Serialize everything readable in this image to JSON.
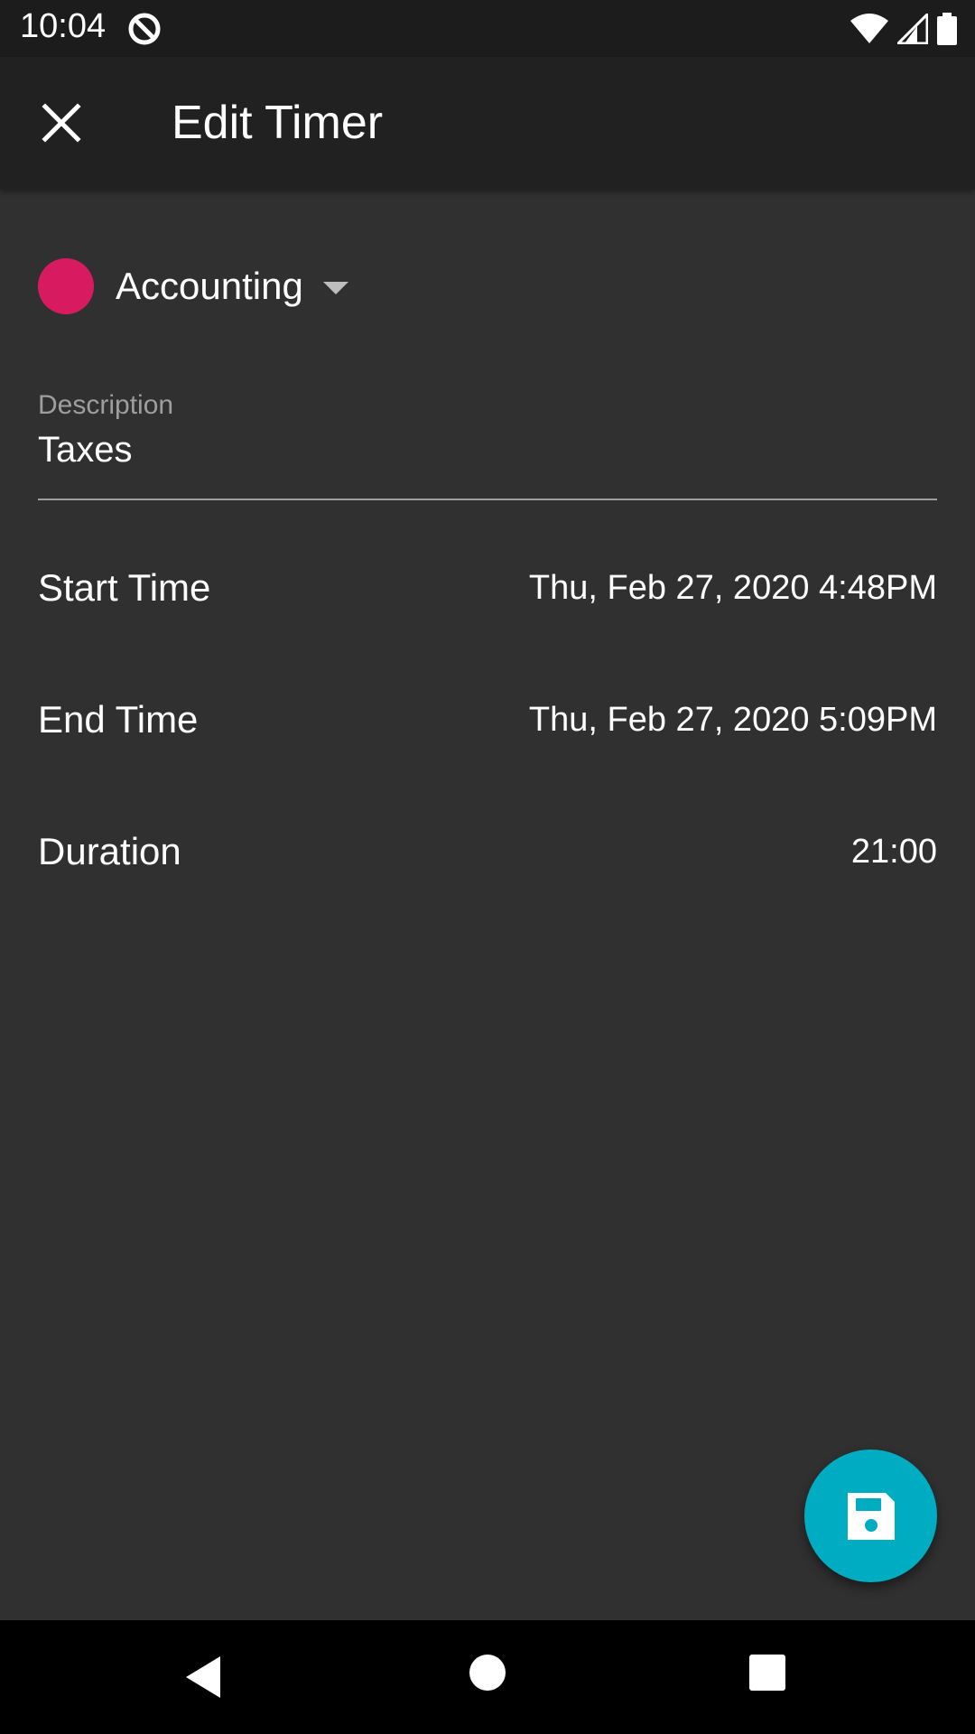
{
  "status_bar": {
    "time": "10:04",
    "icons": [
      "app-notification-icon",
      "wifi-icon",
      "cell-signal-icon",
      "battery-icon"
    ]
  },
  "app_bar": {
    "title": "Edit Timer",
    "close_icon": "close-icon"
  },
  "project": {
    "name": "Accounting",
    "color": "#d81b60",
    "dropdown_icon": "caret-down-icon"
  },
  "description": {
    "label": "Description",
    "value": "Taxes"
  },
  "rows": {
    "start": {
      "label": "Start Time",
      "value": "Thu, Feb 27, 2020 4:48PM"
    },
    "end": {
      "label": "End Time",
      "value": "Thu, Feb 27, 2020 5:09PM"
    },
    "duration": {
      "label": "Duration",
      "value": "21:00"
    }
  },
  "fab": {
    "icon": "save-icon",
    "color": "#00acc1"
  },
  "nav_bar": {
    "icons": [
      "back-icon",
      "home-icon",
      "recents-icon"
    ]
  },
  "theme": {
    "background": "#303030",
    "app_bar": "#212121",
    "status_bar": "#1c1c1c"
  }
}
